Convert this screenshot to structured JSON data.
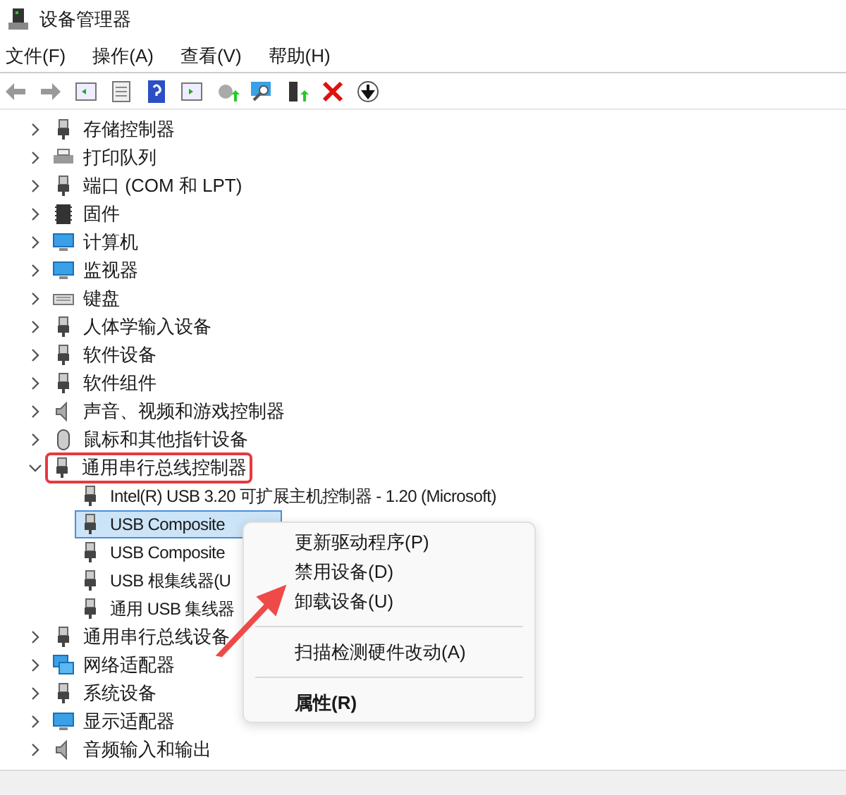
{
  "window": {
    "title": "设备管理器"
  },
  "menu_bar": [
    "文件(F)",
    "操作(A)",
    "查看(V)",
    "帮助(H)"
  ],
  "tree": [
    {
      "label": "存储控制器",
      "expanded": false,
      "highlighted": false
    },
    {
      "label": "打印队列",
      "expanded": false,
      "highlighted": false
    },
    {
      "label": "端口 (COM 和 LPT)",
      "expanded": false,
      "highlighted": false
    },
    {
      "label": "固件",
      "expanded": false,
      "highlighted": false
    },
    {
      "label": "计算机",
      "expanded": false,
      "highlighted": false
    },
    {
      "label": "监视器",
      "expanded": false,
      "highlighted": false
    },
    {
      "label": "键盘",
      "expanded": false,
      "highlighted": false
    },
    {
      "label": "人体学输入设备",
      "expanded": false,
      "highlighted": false
    },
    {
      "label": "软件设备",
      "expanded": false,
      "highlighted": false
    },
    {
      "label": "软件组件",
      "expanded": false,
      "highlighted": false
    },
    {
      "label": "声音、视频和游戏控制器",
      "expanded": false,
      "highlighted": false
    },
    {
      "label": "鼠标和其他指针设备",
      "expanded": false,
      "highlighted": false
    },
    {
      "label": "通用串行总线控制器",
      "expanded": true,
      "highlighted": true,
      "children": [
        {
          "label": "Intel(R) USB 3.20 可扩展主机控制器 - 1.20 (Microsoft)",
          "selected": false
        },
        {
          "label": "USB Composite",
          "selected": true
        },
        {
          "label": "USB Composite",
          "selected": false
        },
        {
          "label": "USB 根集线器(U",
          "selected": false
        },
        {
          "label": "通用 USB 集线器",
          "selected": false
        }
      ]
    },
    {
      "label": "通用串行总线设备",
      "expanded": false,
      "highlighted": false
    },
    {
      "label": "网络适配器",
      "expanded": false,
      "highlighted": false
    },
    {
      "label": "系统设备",
      "expanded": false,
      "highlighted": false
    },
    {
      "label": "显示适配器",
      "expanded": false,
      "highlighted": false
    },
    {
      "label": "音频输入和输出",
      "expanded": false,
      "highlighted": false
    }
  ],
  "context_menu": [
    {
      "kind": "item",
      "label": "更新驱动程序(P)",
      "default": false
    },
    {
      "kind": "item",
      "label": "禁用设备(D)",
      "default": false
    },
    {
      "kind": "item",
      "label": "卸载设备(U)",
      "default": false
    },
    {
      "kind": "separator"
    },
    {
      "kind": "item",
      "label": "扫描检测硬件改动(A)",
      "default": false
    },
    {
      "kind": "separator"
    },
    {
      "kind": "item",
      "label": "属性(R)",
      "default": true
    }
  ]
}
